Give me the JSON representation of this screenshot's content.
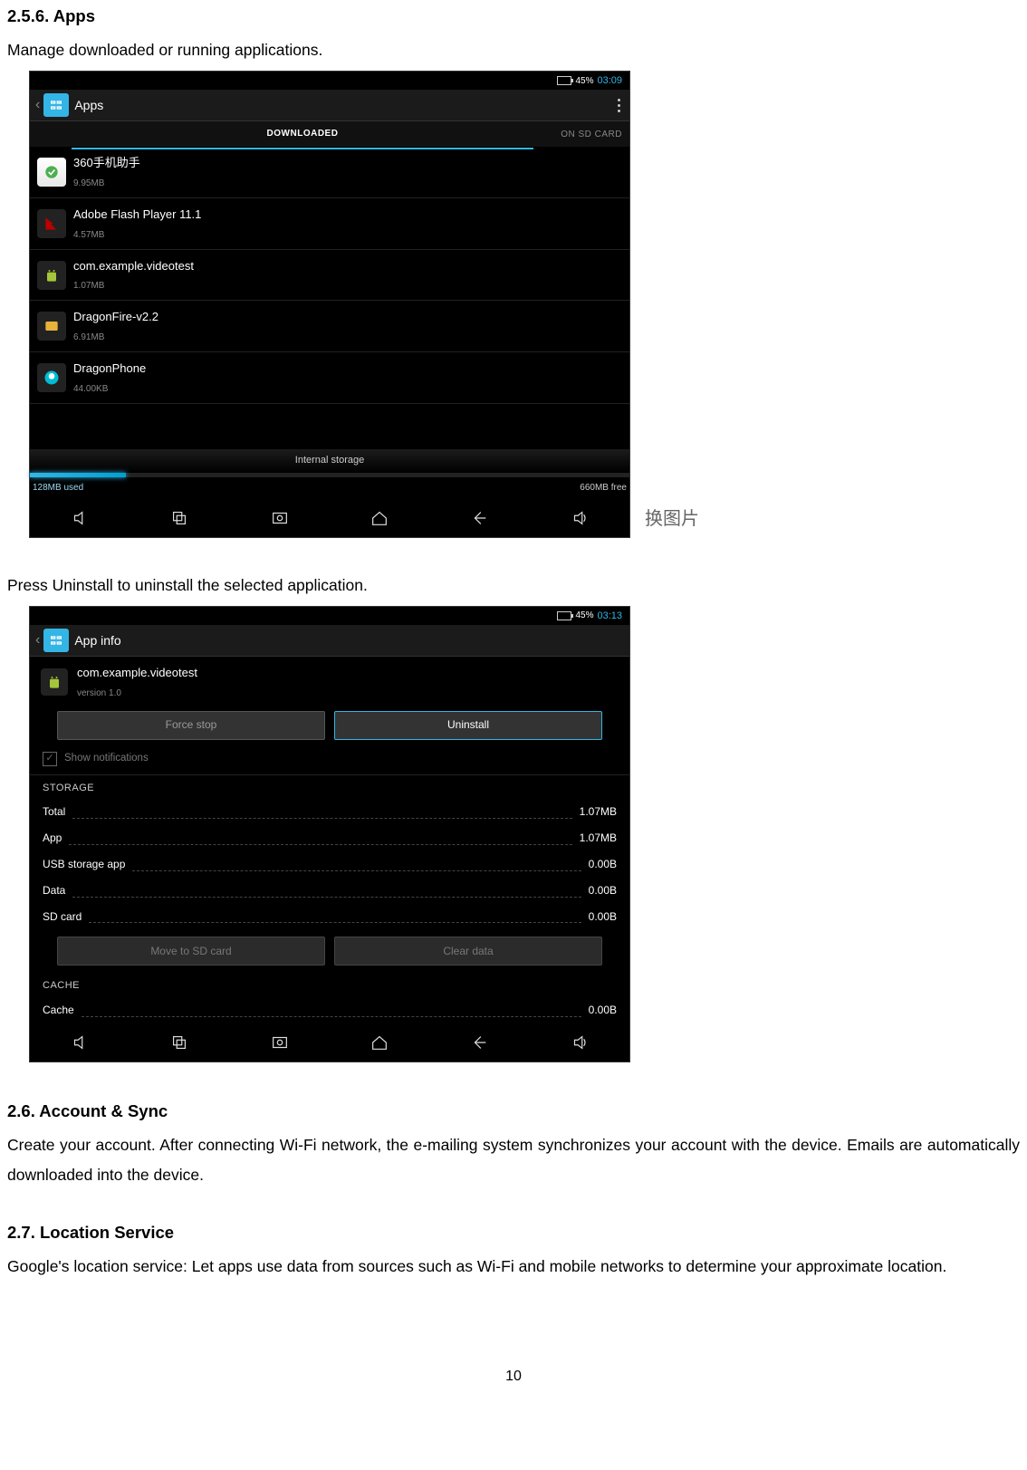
{
  "doc": {
    "h_2_5_6": "2.5.6. Apps",
    "p_2_5_6": "Manage downloaded or running applications.",
    "p_uninstall": "Press Uninstall to uninstall the selected application.",
    "h_2_6": "2.6. Account & Sync",
    "p_2_6": "Create your account. After connecting Wi-Fi network, the e-mailing system synchronizes your account with the device. Emails are automatically downloaded into the device.",
    "h_2_7": "2.7. Location Service",
    "p_2_7": "Google's location service: Let apps use data from sources such as Wi-Fi and mobile networks to determine your approximate location.",
    "side_note": "换图片",
    "page_num": "10"
  },
  "shot1": {
    "status": {
      "battery_pct": "45%",
      "time": "03:09"
    },
    "title": "Apps",
    "tab_active": "DOWNLOADED",
    "tab_right": "ON SD CARD",
    "apps": [
      {
        "name": "360手机助手",
        "size": "9.95MB"
      },
      {
        "name": "Adobe Flash Player 11.1",
        "size": "4.57MB"
      },
      {
        "name": "com.example.videotest",
        "size": "1.07MB"
      },
      {
        "name": "DragonFire-v2.2",
        "size": "6.91MB"
      },
      {
        "name": "DragonPhone",
        "size": "44.00KB"
      }
    ],
    "storage_label": "Internal storage",
    "storage_used": "128MB used",
    "storage_free": "660MB free"
  },
  "shot2": {
    "status": {
      "battery_pct": "45%",
      "time": "03:13"
    },
    "title": "App info",
    "app_name": "com.example.videotest",
    "app_version": "version 1.0",
    "btn_force_stop": "Force stop",
    "btn_uninstall": "Uninstall",
    "show_notifications": "Show notifications",
    "sect_storage": "STORAGE",
    "rows": [
      {
        "k": "Total",
        "v": "1.07MB"
      },
      {
        "k": "App",
        "v": "1.07MB"
      },
      {
        "k": "USB storage app",
        "v": "0.00B"
      },
      {
        "k": "Data",
        "v": "0.00B"
      },
      {
        "k": "SD card",
        "v": "0.00B"
      }
    ],
    "btn_move_sd": "Move to SD card",
    "btn_clear_data": "Clear data",
    "sect_cache": "CACHE",
    "cache_row": {
      "k": "Cache",
      "v": "0.00B"
    }
  }
}
